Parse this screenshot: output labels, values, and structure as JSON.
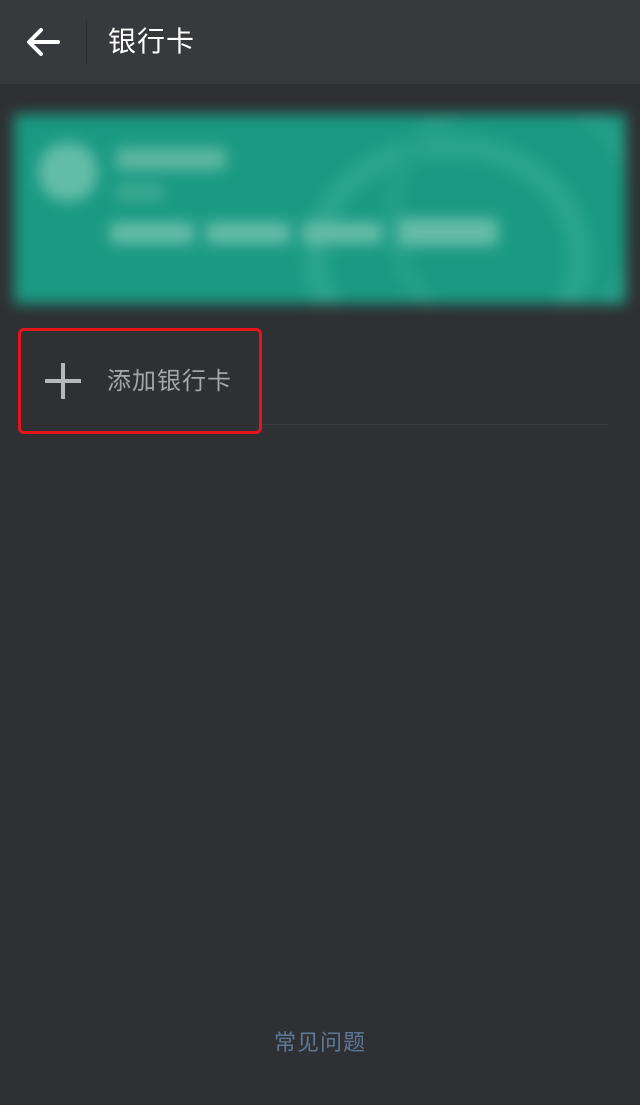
{
  "header": {
    "title": "银行卡",
    "back_icon": "arrow-left-icon"
  },
  "card": {
    "blurred": true,
    "color": "#1a9a82"
  },
  "add_card": {
    "label": "添加银行卡",
    "icon": "plus-icon",
    "highlight_color": "#e8141c"
  },
  "footer": {
    "faq_label": "常见问题"
  }
}
